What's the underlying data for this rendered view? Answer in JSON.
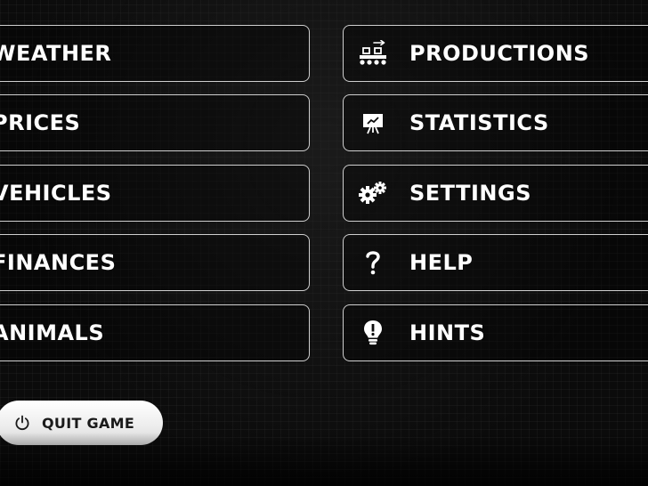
{
  "menu": {
    "left": [
      {
        "label": "WEATHER"
      },
      {
        "label": "PRICES"
      },
      {
        "label": "VEHICLES"
      },
      {
        "label": "FINANCES"
      },
      {
        "label": "ANIMALS"
      }
    ],
    "right": [
      {
        "label": "PRODUCTIONS",
        "icon": "production-conveyor-icon"
      },
      {
        "label": "STATISTICS",
        "icon": "statistics-board-icon"
      },
      {
        "label": "SETTINGS",
        "icon": "gears-icon"
      },
      {
        "label": "HELP",
        "icon": "question-mark-icon"
      },
      {
        "label": "HINTS",
        "icon": "lightbulb-icon"
      }
    ]
  },
  "quit": {
    "label": "QUIT GAME",
    "icon": "power-icon"
  }
}
